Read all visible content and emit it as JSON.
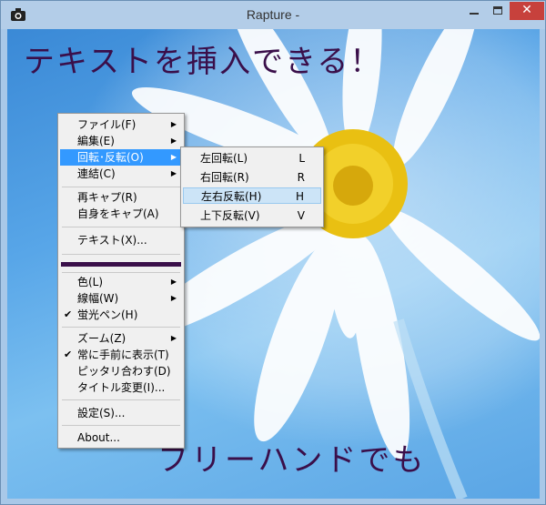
{
  "window": {
    "title": "Rapture -"
  },
  "titlebar": {
    "close_glyph": "✕"
  },
  "canvas": {
    "handwriting_top": "テキストを挿入できる！",
    "handwriting_bottom": "フリーハンドでも",
    "accent_color": "#3a0f4a"
  },
  "main_menu": {
    "items": [
      {
        "label": "ファイル(F)"
      },
      {
        "label": "編集(E)"
      },
      {
        "label": "回転･反転(O)"
      },
      {
        "label": "連結(C)"
      },
      {
        "label": "再キャプ(R)"
      },
      {
        "label": "自身をキャプ(A)"
      },
      {
        "label": "テキスト(X)..."
      },
      {
        "label": "色(L)"
      },
      {
        "label": "線幅(W)"
      },
      {
        "label": "蛍光ペン(H)"
      },
      {
        "label": "ズーム(Z)"
      },
      {
        "label": "常に手前に表示(T)"
      },
      {
        "label": "ピッタリ合わす(D)"
      },
      {
        "label": "タイトル変更(I)..."
      },
      {
        "label": "設定(S)..."
      },
      {
        "label": "About..."
      }
    ],
    "check_glyph": "✔",
    "arrow_glyph": "▶",
    "color_swatch": "#3a0f4a"
  },
  "sub_menu": {
    "items": [
      {
        "label": "左回転(L)",
        "key": "L"
      },
      {
        "label": "右回転(R)",
        "key": "R"
      },
      {
        "label": "左右反転(H)",
        "key": "H"
      },
      {
        "label": "上下反転(V)",
        "key": "V"
      }
    ]
  }
}
